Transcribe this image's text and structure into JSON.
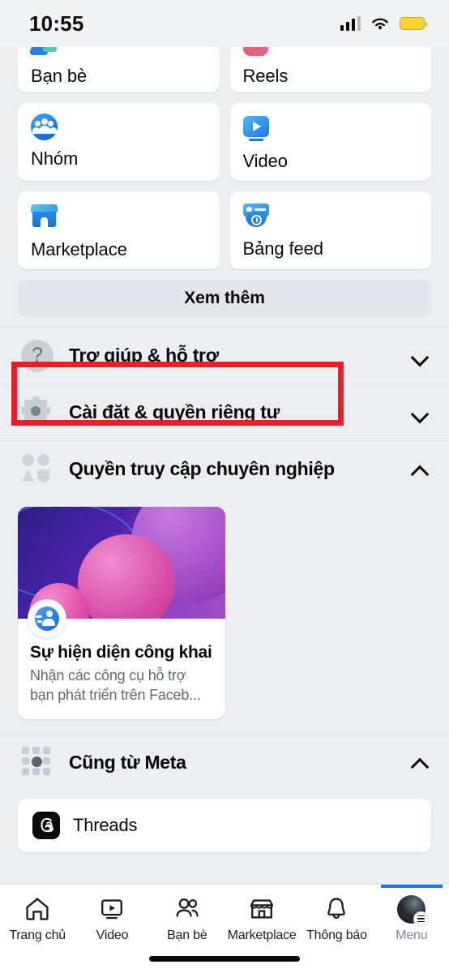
{
  "status_bar": {
    "time": "10:55",
    "signal_icon": "cellular-bars-icon",
    "wifi_icon": "wifi-icon",
    "battery_icon": "battery-low-power-icon"
  },
  "shortcuts": {
    "tiles": [
      {
        "label": "Bạn bè",
        "icon": "friends-icon"
      },
      {
        "label": "Reels",
        "icon": "reels-icon"
      },
      {
        "label": "Nhóm",
        "icon": "groups-icon"
      },
      {
        "label": "Video",
        "icon": "video-icon"
      },
      {
        "label": "Marketplace",
        "icon": "marketplace-icon"
      },
      {
        "label": "Bảng feed",
        "icon": "feeds-icon"
      }
    ],
    "see_more_label": "Xem thêm"
  },
  "sections": [
    {
      "label": "Trợ giúp & hỗ trợ",
      "icon": "help-circle-icon",
      "chevron": "chevron-down",
      "expanded": false,
      "highlighted": true
    },
    {
      "label": "Cài đặt & quyền riêng tư",
      "icon": "gear-icon",
      "chevron": "chevron-down",
      "expanded": false,
      "highlighted": false
    },
    {
      "label": "Quyền truy cập chuyên nghiệp",
      "icon": "professional-access-icon",
      "chevron": "chevron-up",
      "expanded": true,
      "highlighted": false
    },
    {
      "label": "Cũng từ Meta",
      "icon": "meta-apps-icon",
      "chevron": "chevron-up",
      "expanded": true,
      "highlighted": false
    }
  ],
  "professional_card": {
    "title": "Sự hiện diện công khai",
    "subtitle": "Nhận các công cụ hỗ trợ bạn phát triển trên Faceb...",
    "badge_icon": "public-presence-icon",
    "image": "purple-spheres-illustration"
  },
  "meta_apps": [
    {
      "label": "Threads",
      "icon": "threads-icon"
    }
  ],
  "annotation": {
    "color": "#ed1c24",
    "target": "Trợ giúp & hỗ trợ"
  },
  "tab_bar": {
    "tabs": [
      {
        "label": "Trang chủ",
        "icon": "home-icon",
        "active": false
      },
      {
        "label": "Video",
        "icon": "video-icon",
        "active": false
      },
      {
        "label": "Bạn bè",
        "icon": "friends-icon",
        "active": false
      },
      {
        "label": "Marketplace",
        "icon": "marketplace-icon",
        "active": false
      },
      {
        "label": "Thông báo",
        "icon": "bell-icon",
        "active": false
      },
      {
        "label": "Menu",
        "icon": "avatar-menu-icon",
        "active": true
      }
    ],
    "active_color": "#1b74e4"
  }
}
